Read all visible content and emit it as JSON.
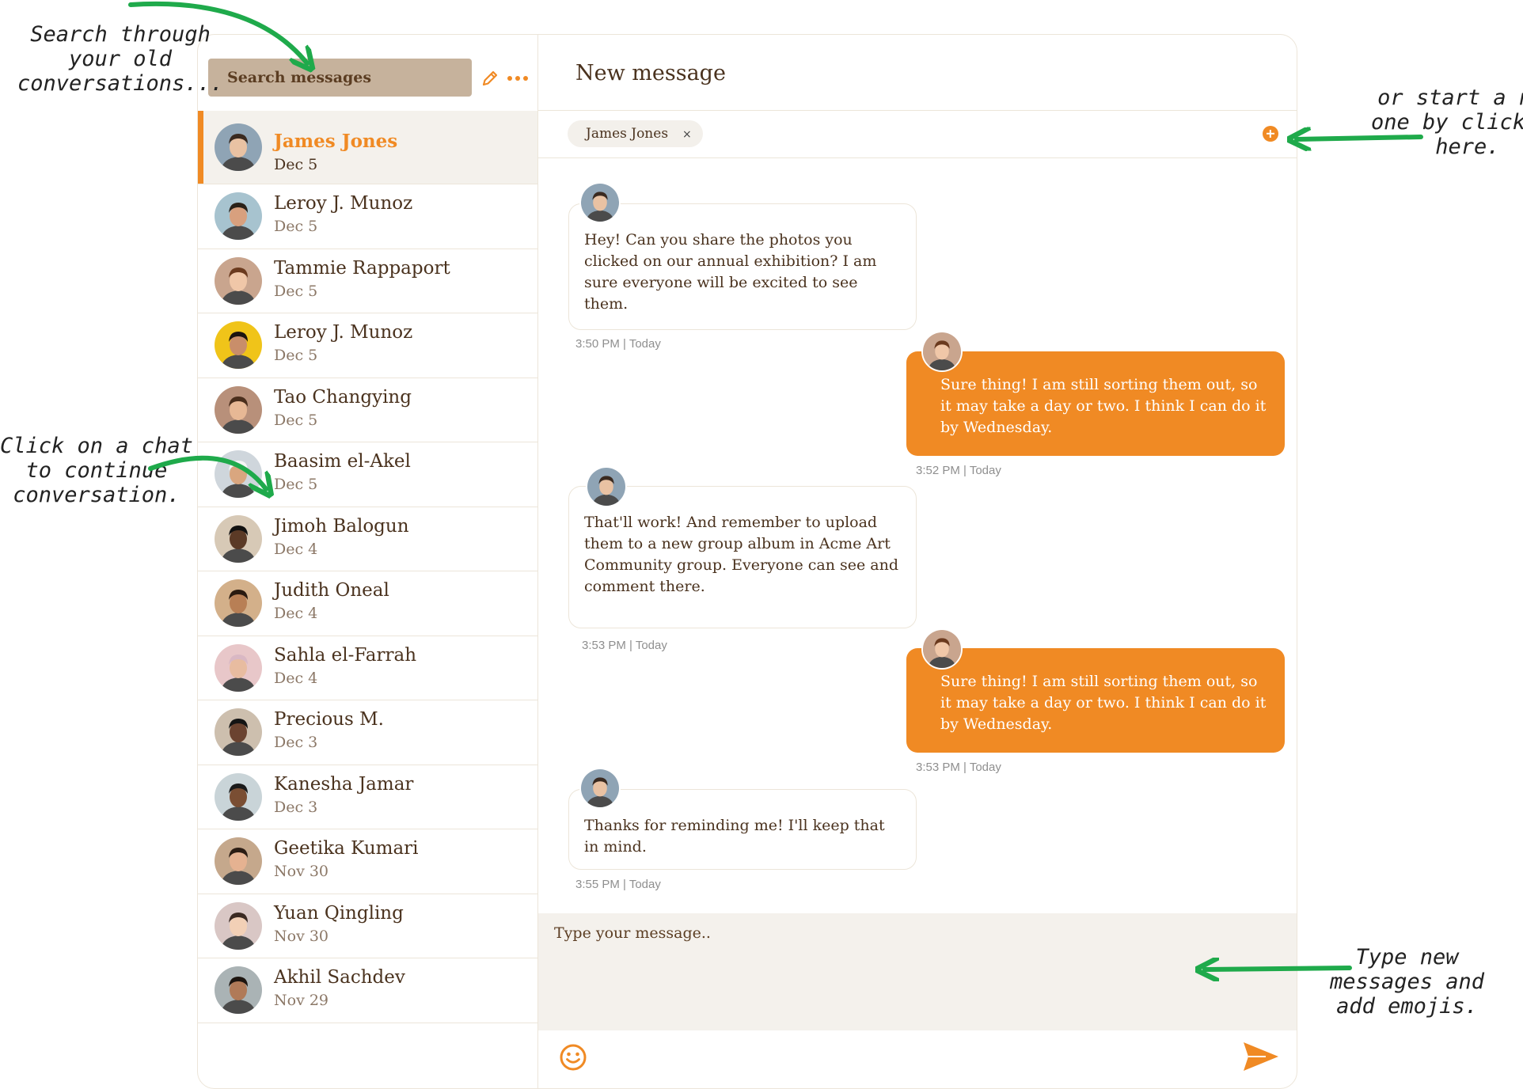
{
  "sidebar": {
    "search_label": "Search messages",
    "icons": {
      "edit": "pencil-icon",
      "more": "ellipsis-icon"
    },
    "conversations": [
      {
        "name": "James Jones",
        "date": "Dec 5",
        "active": true
      },
      {
        "name": "Leroy J. Munoz",
        "date": "Dec 5"
      },
      {
        "name": "Tammie Rappaport",
        "date": "Dec 5"
      },
      {
        "name": "Leroy J. Munoz",
        "date": "Dec 5"
      },
      {
        "name": "Tao Changying",
        "date": "Dec 5"
      },
      {
        "name": "Baasim el-Akel",
        "date": "Dec 5"
      },
      {
        "name": "Jimoh Balogun",
        "date": "Dec 4"
      },
      {
        "name": "Judith Oneal",
        "date": "Dec 4"
      },
      {
        "name": "Sahla el-Farrah",
        "date": "Dec 4"
      },
      {
        "name": "Precious M.",
        "date": "Dec 3"
      },
      {
        "name": "Kanesha Jamar",
        "date": "Dec 3"
      },
      {
        "name": "Geetika Kumari",
        "date": "Nov 30"
      },
      {
        "name": "Yuan Qingling",
        "date": "Nov 30"
      },
      {
        "name": "Akhil Sachdev",
        "date": "Nov 29"
      }
    ]
  },
  "main": {
    "title": "New message",
    "recipient_chip": "James Jones",
    "chip_remove": "×",
    "messages": [
      {
        "direction": "in",
        "text": "Hey! Can you share the photos you clicked on our annual exhibition? I am sure everyone will be excited to see them.",
        "time": "3:50 PM | Today"
      },
      {
        "direction": "out",
        "text": "Sure thing! I am still sorting them out, so it may take a day or two. I think I can do it by Wednesday.",
        "time": "3:52 PM | Today"
      },
      {
        "direction": "in",
        "text": "That'll work! And remember to upload them to a new group album in Acme Art Community group. Everyone can see and comment there.",
        "time": "3:53 PM | Today"
      },
      {
        "direction": "out",
        "text": "Sure thing! I am still sorting them out, so it may take a day or two. I think I can do it by Wednesday.",
        "time": "3:53 PM | Today"
      },
      {
        "direction": "in",
        "text": "Thanks for reminding me! I'll keep that in mind.",
        "time": "3:55 PM | Today"
      }
    ],
    "composer_placeholder": "Type your message..",
    "icons": {
      "emoji": "smiley-icon",
      "send": "send-icon",
      "add": "plus-circle-icon"
    }
  },
  "annotations": {
    "search": "Search through\nyour old\nconversations...",
    "click": "Click on a chat\nto continue\nconversation.",
    "start": "or start a new\none by clicking\nhere.",
    "type": "Type new\nmessages and\nadd emojis."
  },
  "colors": {
    "accent": "#f08a24",
    "search_bg": "#c6b29c",
    "annotation_arrow": "#1faa4b",
    "text": "#4a321e"
  }
}
